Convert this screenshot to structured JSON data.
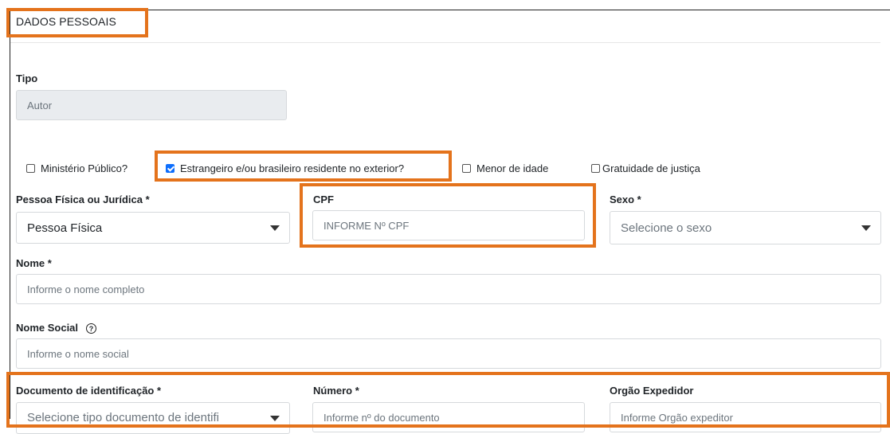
{
  "section": {
    "title": "DADOS PESSOAIS"
  },
  "tipo": {
    "label": "Tipo",
    "value": "Autor"
  },
  "checkboxes": [
    {
      "label": "Ministério Público?",
      "checked": false
    },
    {
      "label": "Estrangeiro e/ou brasileiro residente no exterior?",
      "checked": true
    },
    {
      "label": "Menor de idade",
      "checked": false
    },
    {
      "label": "Gratuidade de justiça",
      "checked": false
    }
  ],
  "pessoa": {
    "label": "Pessoa Física ou Jurídica *",
    "value": "Pessoa Física"
  },
  "cpf": {
    "label": "CPF",
    "placeholder": "INFORME Nº CPF"
  },
  "sexo": {
    "label": "Sexo *",
    "placeholder": "Selecione o sexo"
  },
  "nome": {
    "label": "Nome *",
    "placeholder": "Informe o nome completo"
  },
  "nome_social": {
    "label": "Nome Social",
    "placeholder": "Informe o nome social",
    "help_icon": "question-circle-icon"
  },
  "documento": {
    "label": "Documento de identificação *",
    "placeholder": "Selecione tipo documento de identifi"
  },
  "numero": {
    "label": "Número *",
    "placeholder": "Informe nº do documento"
  },
  "orgao": {
    "label": "Orgão Expedidor",
    "placeholder": "Informe Orgão expeditor"
  },
  "colors": {
    "highlight": "#e4731c",
    "checkbox_checked": "#0d6efd"
  }
}
